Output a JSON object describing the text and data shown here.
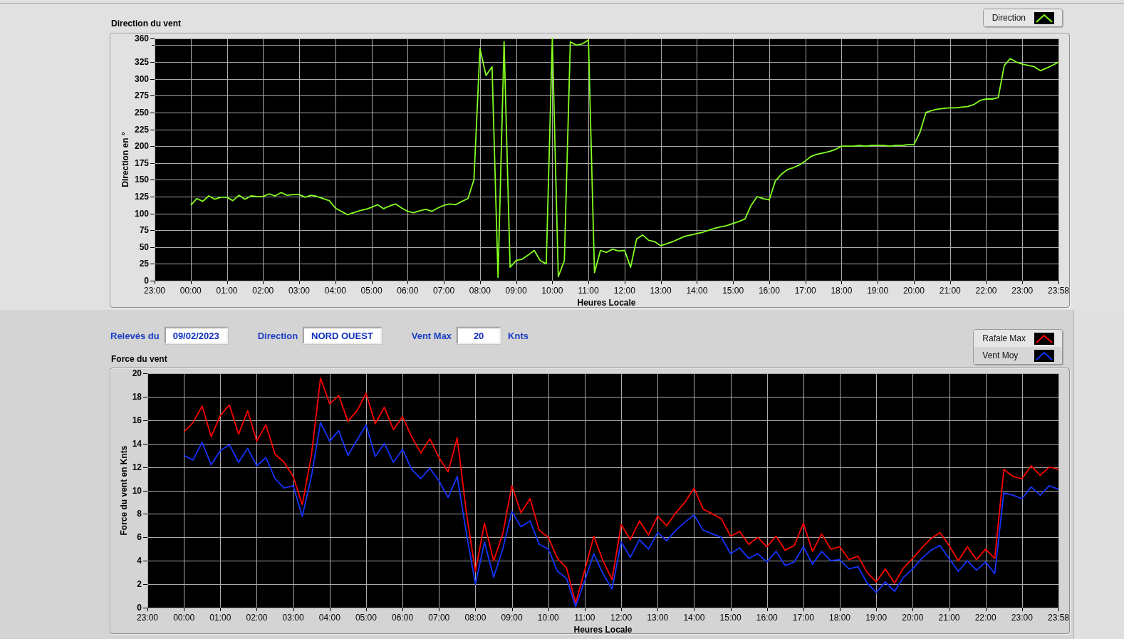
{
  "direction_chart": {
    "chart_data": {
      "type": "line",
      "title": "Direction du vent",
      "xlabel": "Heures Locale",
      "ylabel": "Direction en °",
      "grid": true,
      "ylim": [
        0,
        360
      ],
      "yticks": [
        0,
        25,
        50,
        75,
        100,
        125,
        150,
        175,
        200,
        225,
        250,
        275,
        300,
        325,
        360
      ],
      "categories": [
        "23:00",
        null,
        null,
        null,
        null,
        null,
        "00:00",
        null,
        null,
        null,
        null,
        null,
        "01:00",
        null,
        null,
        null,
        null,
        null,
        "02:00",
        null,
        null,
        null,
        null,
        null,
        "03:00",
        null,
        null,
        null,
        null,
        null,
        "04:00",
        null,
        null,
        null,
        null,
        null,
        "05:00",
        null,
        null,
        null,
        null,
        null,
        "06:00",
        null,
        null,
        null,
        null,
        null,
        "07:00",
        null,
        null,
        null,
        null,
        null,
        "08:00",
        null,
        null,
        null,
        null,
        null,
        "09:00",
        null,
        null,
        null,
        null,
        null,
        "10:00",
        null,
        null,
        null,
        null,
        null,
        "11:00",
        null,
        null,
        null,
        null,
        null,
        "12:00",
        null,
        null,
        null,
        null,
        null,
        "13:00",
        null,
        null,
        null,
        null,
        null,
        "14:00",
        null,
        null,
        null,
        null,
        null,
        "15:00",
        null,
        null,
        null,
        null,
        null,
        "16:00",
        null,
        null,
        null,
        null,
        null,
        "17:00",
        null,
        null,
        null,
        null,
        null,
        "18:00",
        null,
        null,
        null,
        null,
        null,
        "19:00",
        null,
        null,
        null,
        null,
        null,
        "20:00",
        null,
        null,
        null,
        null,
        null,
        "21:00",
        null,
        null,
        null,
        null,
        null,
        "22:00",
        null,
        null,
        null,
        null,
        null,
        "23:00",
        null,
        null,
        null,
        null,
        null,
        "23:58"
      ],
      "series": [
        {
          "name": "Direction",
          "color": "#84ff20",
          "values": [
            null,
            null,
            null,
            null,
            null,
            null,
            112,
            122,
            118,
            126,
            121,
            124,
            124,
            119,
            127,
            121,
            126,
            125,
            125,
            129,
            126,
            131,
            127,
            128,
            128,
            124,
            127,
            125,
            122,
            119,
            108,
            103,
            98,
            101,
            104,
            106,
            109,
            113,
            107,
            111,
            114,
            108,
            103,
            101,
            104,
            106,
            103,
            108,
            112,
            114,
            113,
            118,
            122,
            150,
            345,
            305,
            318,
            5,
            355,
            20,
            30,
            32,
            38,
            45,
            30,
            25,
            360,
            6,
            30,
            355,
            350,
            352,
            358,
            12,
            45,
            42,
            47,
            44,
            45,
            20,
            62,
            68,
            60,
            58,
            52,
            55,
            58,
            62,
            66,
            68,
            70,
            72,
            75,
            78,
            80,
            82,
            85,
            88,
            92,
            112,
            125,
            122,
            120,
            148,
            158,
            165,
            168,
            172,
            178,
            185,
            188,
            190,
            192,
            195,
            200,
            200,
            200,
            201,
            200,
            201,
            201,
            201,
            200,
            201,
            201,
            202,
            202,
            220,
            250,
            253,
            255,
            256,
            257,
            257,
            258,
            259,
            262,
            268,
            270,
            270,
            272,
            320,
            330,
            325,
            322,
            320,
            318,
            312,
            316,
            320,
            325
          ]
        }
      ]
    }
  },
  "readings": [
    {
      "label": "Relevés du",
      "value": "09/02/2023"
    },
    {
      "label": "Direction",
      "value": "NORD OUEST"
    },
    {
      "label": "Vent Max",
      "value": "20",
      "unit": "Knts"
    }
  ],
  "force_chart": {
    "chart_data": {
      "type": "line",
      "title": "Force du vent",
      "xlabel": "Heures Locale",
      "ylabel": "Force du vent en Knts",
      "grid": true,
      "ylim": [
        0,
        20
      ],
      "yticks": [
        0,
        2,
        4,
        6,
        8,
        10,
        12,
        14,
        16,
        18,
        20
      ],
      "categories": [
        "23:00",
        null,
        null,
        null,
        "00:00",
        null,
        null,
        null,
        "01:00",
        null,
        null,
        null,
        "02:00",
        null,
        null,
        null,
        "03:00",
        null,
        null,
        null,
        "04:00",
        null,
        null,
        null,
        "05:00",
        null,
        null,
        null,
        "06:00",
        null,
        null,
        null,
        "07:00",
        null,
        null,
        null,
        "08:00",
        null,
        null,
        null,
        "09:00",
        null,
        null,
        null,
        "10:00",
        null,
        null,
        null,
        "11:00",
        null,
        null,
        null,
        "12:00",
        null,
        null,
        null,
        "13:00",
        null,
        null,
        null,
        "14:00",
        null,
        null,
        null,
        "15:00",
        null,
        null,
        null,
        "16:00",
        null,
        null,
        null,
        "17:00",
        null,
        null,
        null,
        "18:00",
        null,
        null,
        null,
        "19:00",
        null,
        null,
        null,
        "20:00",
        null,
        null,
        null,
        "21:00",
        null,
        null,
        null,
        "22:00",
        null,
        null,
        null,
        "23:00",
        null,
        null,
        null,
        "23:58"
      ],
      "series": [
        {
          "name": "Rafale Max",
          "color": "#ff0000",
          "values": [
            null,
            null,
            null,
            null,
            15,
            15.8,
            17.2,
            14.6,
            16.4,
            17.3,
            14.8,
            16.8,
            14.2,
            15.6,
            13.1,
            12.4,
            11.2,
            8.8,
            13,
            19.6,
            17.4,
            18.1,
            15.9,
            16.8,
            18.3,
            15.7,
            17.1,
            15.2,
            16.3,
            14.6,
            13.2,
            14.4,
            12.8,
            11.6,
            14.5,
            8.2,
            3.1,
            7.2,
            4,
            6.3,
            10.4,
            8.1,
            9.3,
            6.6,
            6,
            4.2,
            3.4,
            0.4,
            3.2,
            6.1,
            4,
            2.4,
            7.1,
            5.8,
            7.4,
            6.2,
            7.8,
            7,
            8.1,
            9,
            10.2,
            8.4,
            8,
            7.6,
            6.1,
            6.5,
            5.4,
            6,
            5.2,
            6.1,
            4.9,
            5.3,
            7.2,
            4.8,
            6.3,
            5,
            5.2,
            4.1,
            4.4,
            3,
            2.2,
            3.3,
            2.1,
            3.4,
            4.2,
            5.1,
            5.9,
            6.4,
            5.3,
            4,
            5.2,
            4.1,
            5,
            4.2,
            11.8,
            11.2,
            11,
            12.1,
            11.3,
            12,
            11.8
          ]
        },
        {
          "name": "Vent Moy",
          "color": "#1433ff",
          "values": [
            null,
            null,
            null,
            null,
            13,
            12.6,
            14.1,
            12.2,
            13.4,
            13.9,
            12.4,
            13.6,
            12.1,
            12.8,
            11,
            10.2,
            10.4,
            7.8,
            11.2,
            15.8,
            14.2,
            15.1,
            13,
            14.3,
            15.6,
            12.9,
            14,
            12.4,
            13.5,
            11.8,
            11,
            11.9,
            10.8,
            9.4,
            11.2,
            6.4,
            2,
            5.6,
            2.6,
            5,
            8.2,
            6.9,
            7.4,
            5.4,
            5,
            3.1,
            2.5,
            0.1,
            2.3,
            4.6,
            2.9,
            1.6,
            5.6,
            4.3,
            5.8,
            5,
            6.4,
            5.7,
            6.6,
            7.3,
            7.9,
            6.6,
            6.3,
            6,
            4.6,
            5.1,
            4.2,
            4.6,
            3.9,
            4.8,
            3.6,
            3.9,
            5.2,
            3.7,
            4.8,
            4,
            4.1,
            3.3,
            3.5,
            2.1,
            1.3,
            2.2,
            1.4,
            2.6,
            3.3,
            4.2,
            4.9,
            5.3,
            4.2,
            3.1,
            4,
            3.2,
            3.9,
            2.9,
            9.8,
            9.6,
            9.3,
            10.3,
            9.6,
            10.4,
            10.1
          ]
        }
      ]
    }
  }
}
